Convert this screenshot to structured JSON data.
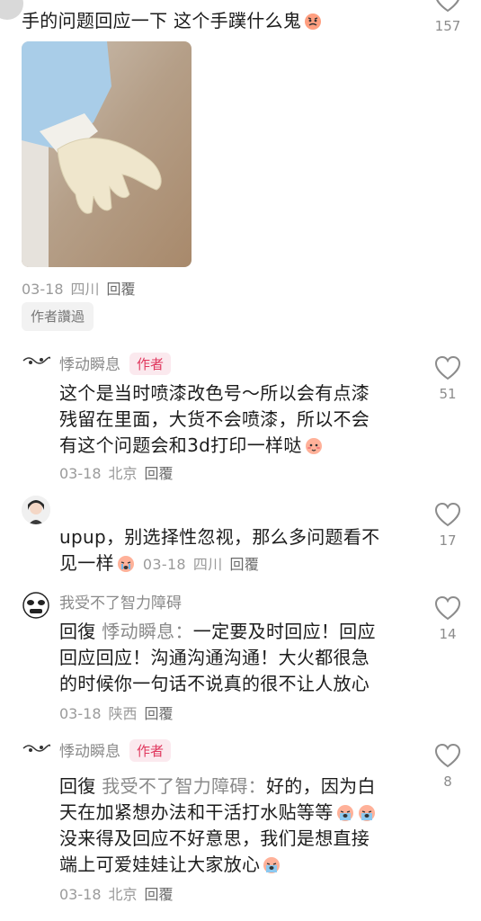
{
  "top_comment": {
    "text": "手的问题回应一下 这个手蹼什么鬼",
    "emoji": "angry-face-emoji",
    "likes": "157",
    "date": "03-18",
    "location": "四川",
    "reply_label": "回覆",
    "approved_label": "作者讚過"
  },
  "comments": [
    {
      "author": "悸动瞬息",
      "author_tag": "作者",
      "lines": [
        "这个是当时喷漆改色号～所以会有点漆",
        "残留在里面，大货不会喷漆，所以不会",
        "有这个问题会和3d打印一样哒"
      ],
      "date": "03-18",
      "location": "北京",
      "reply_label": "回覆",
      "likes": "51"
    },
    {
      "author": "",
      "lines": [
        "upup，别选择性忽视，那么多问题看不",
        "见一样"
      ],
      "date": "03-18",
      "location": "四川",
      "reply_label": "回覆",
      "likes": "17"
    },
    {
      "author": "我受不了智力障碍",
      "reply_prefix": "回復",
      "mention": "悸动瞬息：",
      "lines": [
        "一定要及时回应！回应",
        "回应回应！沟通沟通沟通！大火都很急",
        "的时候你一句话不说真的很不让人放心"
      ],
      "date": "03-18",
      "location": "陕西",
      "reply_label": "回覆",
      "likes": "14"
    },
    {
      "author": "悸动瞬息",
      "author_tag": "作者",
      "reply_prefix": "回復",
      "mention": "我受不了智力障碍：",
      "lines": [
        "好的，因为白",
        "天在加紧想办法和干活打水贴等等",
        "没来得及回应不好意思，我们是想直接",
        "端上可爱娃娃让大家放心"
      ],
      "date": "03-18",
      "location": "北京",
      "reply_label": "回覆",
      "likes": "8"
    }
  ],
  "colors": {
    "author_tag_bg": "#fbe9ee",
    "author_tag_text": "#e0385e",
    "meta": "#9a9a9a"
  }
}
